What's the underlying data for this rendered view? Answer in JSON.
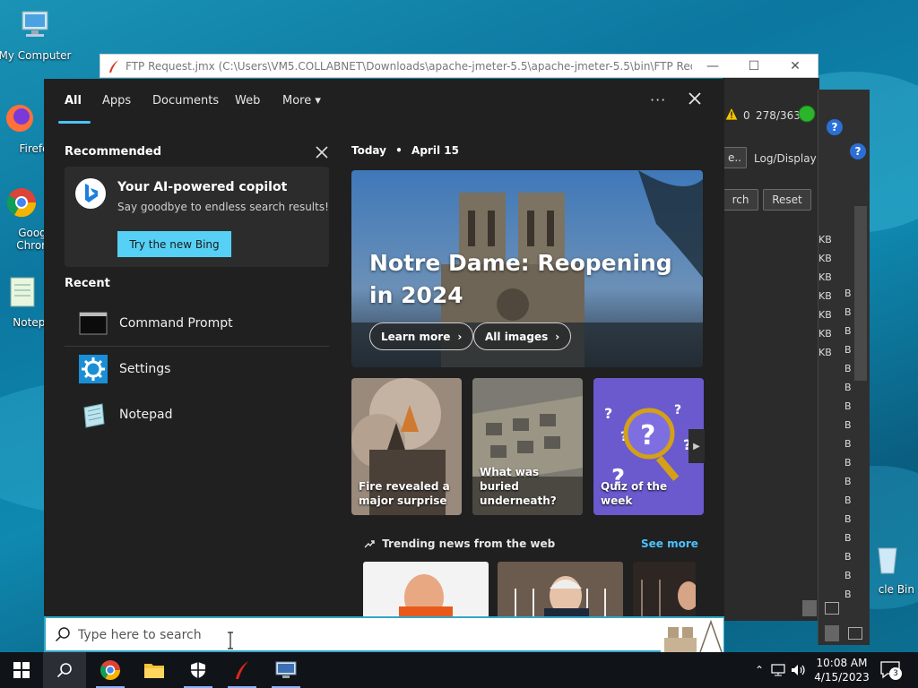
{
  "desktop": {
    "icons": [
      {
        "name": "my-computer",
        "label": "My Computer"
      },
      {
        "name": "firefox",
        "label": "Firefo"
      },
      {
        "name": "chrome",
        "label": "Goog\nChron"
      },
      {
        "name": "notepad",
        "label": "Notepa"
      },
      {
        "name": "recycle-bin",
        "label": "cle Bin"
      }
    ]
  },
  "jmeter": {
    "title": "FTP Request.jmx (C:\\Users\\VM5.COLLABNET\\Downloads\\apache-jmeter-5.5\\apache-jmeter-5.5\\bin\\FTP Request.jmx) ...",
    "counter_zero": "0",
    "counter": "278/363",
    "log_display": "Log/Display",
    "reset": "Reset",
    "search_partial": "rch",
    "e_partial": "e..",
    "kb": "KB",
    "b": "B"
  },
  "search": {
    "tabs": [
      "All",
      "Apps",
      "Documents",
      "Web",
      "More"
    ],
    "more_caret": "▾",
    "options": "···",
    "recommended_title": "Recommended",
    "copilot": {
      "heading": "Your AI-powered copilot",
      "sub": "Say goodbye to endless search results!",
      "button": "Try the new Bing"
    },
    "recent_title": "Recent",
    "recent": [
      "Command Prompt",
      "Settings",
      "Notepad"
    ],
    "today": "Today",
    "bullet": "•",
    "date": "April 15",
    "hero": {
      "title": "Notre Dame: Reopening in 2024",
      "learn_more": "Learn more",
      "all_images": "All images",
      "chevron": "›"
    },
    "cards": [
      "Fire revealed a major surprise",
      "What was buried underneath?",
      "Quiz of the week"
    ],
    "trending": "Trending news from the web",
    "see_more": "See more",
    "placeholder": "Type here to search"
  },
  "taskbar": {
    "time": "10:08 AM",
    "date": "4/15/2023",
    "notification_count": "3"
  },
  "colors": {
    "accent": "#4cc2ff",
    "panel_bg": "#202020",
    "bing_button": "#56d1f5"
  }
}
